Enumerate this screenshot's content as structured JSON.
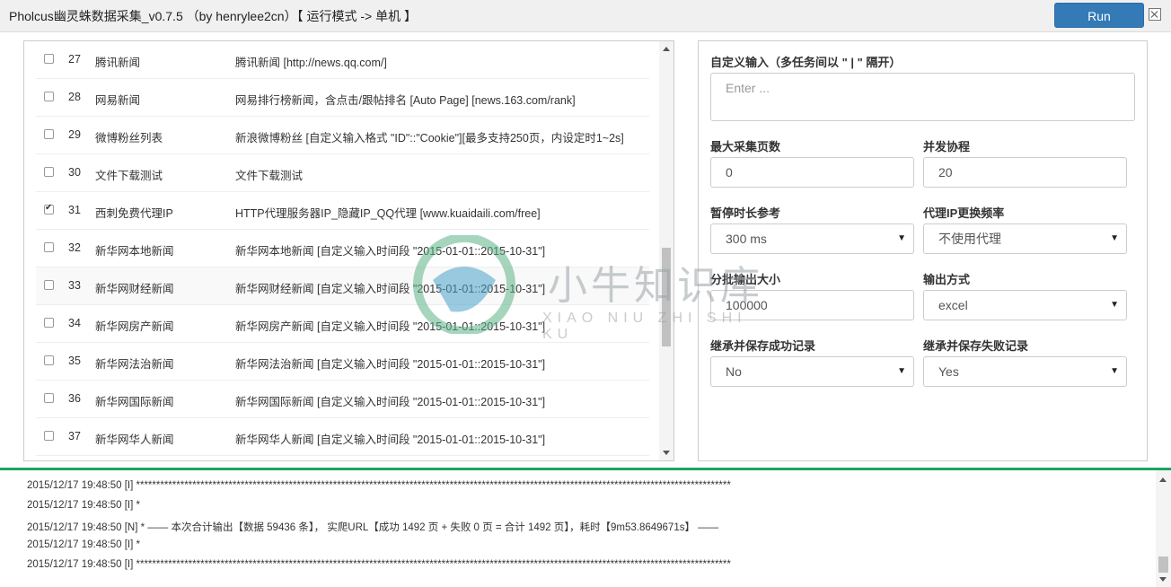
{
  "window": {
    "title": "Pholcus幽灵蛛数据采集_v0.7.5 （by henrylee2cn）【 运行模式 -> 单机 】",
    "run_label": "Run"
  },
  "spiders": [
    {
      "index": "27",
      "name": "腾讯新闻",
      "desc": "腾讯新闻 [http://news.qq.com/]",
      "checked": false
    },
    {
      "index": "28",
      "name": "网易新闻",
      "desc": "网易排行榜新闻，含点击/跟帖排名 [Auto Page] [news.163.com/rank]",
      "checked": false
    },
    {
      "index": "29",
      "name": "微博粉丝列表",
      "desc": "新浪微博粉丝 [自定义输入格式 \"ID\"::\"Cookie\"][最多支持250页，内设定时1~2s]",
      "checked": false
    },
    {
      "index": "30",
      "name": "文件下载测试",
      "desc": "文件下载测试",
      "checked": false
    },
    {
      "index": "31",
      "name": "西刺免费代理IP",
      "desc": "HTTP代理服务器IP_隐藏IP_QQ代理 [www.kuaidaili.com/free]",
      "checked": true
    },
    {
      "index": "32",
      "name": "新华网本地新闻",
      "desc": "新华网本地新闻 [自定义输入时间段 \"2015-01-01::2015-10-31\"]",
      "checked": false
    },
    {
      "index": "33",
      "name": "新华网财经新闻",
      "desc": "新华网财经新闻 [自定义输入时间段 \"2015-01-01::2015-10-31\"]",
      "checked": false
    },
    {
      "index": "34",
      "name": "新华网房产新闻",
      "desc": "新华网房产新闻 [自定义输入时间段 \"2015-01-01::2015-10-31\"]",
      "checked": false
    },
    {
      "index": "35",
      "name": "新华网法治新闻",
      "desc": "新华网法治新闻 [自定义输入时间段 \"2015-01-01::2015-10-31\"]",
      "checked": false
    },
    {
      "index": "36",
      "name": "新华网国际新闻",
      "desc": "新华网国际新闻 [自定义输入时间段 \"2015-01-01::2015-10-31\"]",
      "checked": false
    },
    {
      "index": "37",
      "name": "新华网华人新闻",
      "desc": "新华网华人新闻 [自定义输入时间段 \"2015-01-01::2015-10-31\"]",
      "checked": false
    }
  ],
  "form": {
    "custom_input_label": "自定义输入（多任务间以 \" | \" 隔开）",
    "custom_input_placeholder": "Enter ...",
    "max_pages_label": "最大采集页数",
    "max_pages_value": "0",
    "concurrency_label": "并发协程",
    "concurrency_value": "20",
    "pause_label": "暂停时长参考",
    "pause_value": "300 ms",
    "proxy_label": "代理IP更换频率",
    "proxy_value": "不使用代理",
    "batch_label": "分批输出大小",
    "batch_value": "100000",
    "output_label": "输出方式",
    "output_value": "excel",
    "inherit_success_label": "继承并保存成功记录",
    "inherit_success_value": "No",
    "inherit_fail_label": "继承并保存失败记录",
    "inherit_fail_value": "Yes"
  },
  "log": [
    "2015/12/17 19:48:50 [I]  ****************************************************************************************************************************************************",
    "2015/12/17 19:48:50 [I]  *",
    "2015/12/17 19:48:50 [N]  *                    —— 本次合计输出【数据 59436 条】， 实爬URL【成功 1492 页 + 失败 0 页 = 合计 1492 页】，耗时【9m53.8649671s】 ——",
    "2015/12/17 19:48:50 [I]  *",
    "2015/12/17 19:48:50 [I]  ****************************************************************************************************************************************************"
  ],
  "watermark": {
    "text": "小牛知识库",
    "sub": "XIAO NIU ZHI SHI KU"
  },
  "colors": {
    "accent": "#337ab7",
    "log_border": "#1fa363"
  }
}
